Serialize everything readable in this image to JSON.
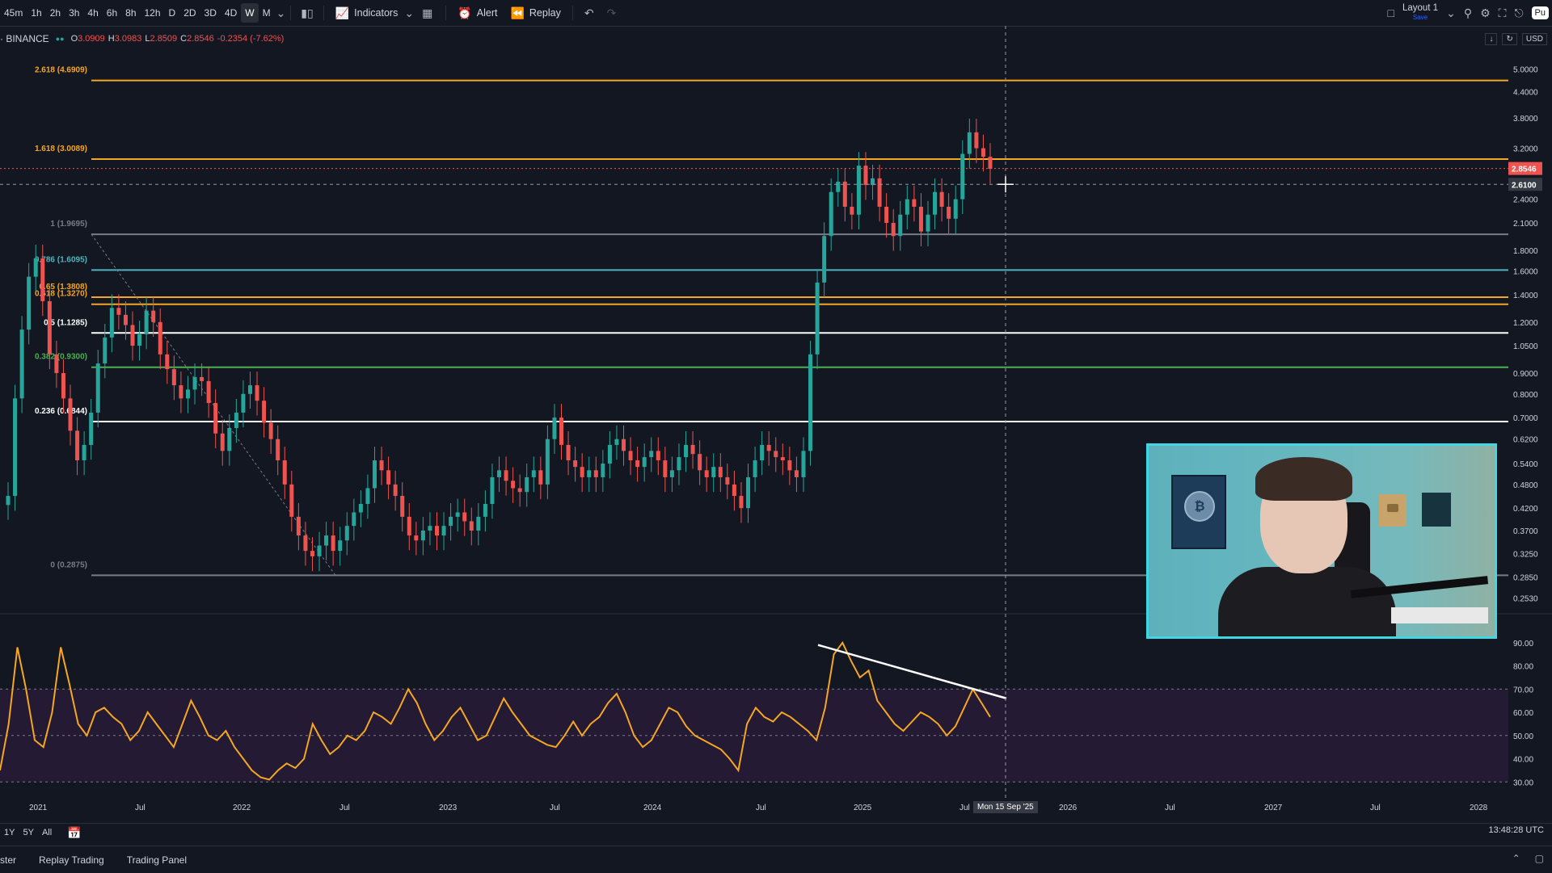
{
  "toolbar": {
    "timeframes": [
      "45m",
      "1h",
      "2h",
      "3h",
      "4h",
      "6h",
      "8h",
      "12h",
      "D",
      "2D",
      "3D",
      "4D",
      "W",
      "M"
    ],
    "active_timeframe": "W",
    "indicators_label": "Indicators",
    "alert_label": "Alert",
    "replay_label": "Replay",
    "layout_label": "Layout 1",
    "layout_save": "Save",
    "publish_label": "Pu"
  },
  "legend": {
    "exchange": "· BINANCE",
    "ohlc": [
      {
        "k": "O",
        "v": "3.0909"
      },
      {
        "k": "H",
        "v": "3.0983"
      },
      {
        "k": "L",
        "v": "2.8509"
      },
      {
        "k": "C",
        "v": "2.8546"
      },
      {
        "k": "",
        "v": "-0.2354 (-7.62%)"
      }
    ]
  },
  "axis_controls": {
    "currency": "USD"
  },
  "fib_levels": [
    {
      "label": "2.618 (4.6909)",
      "price": 4.6909,
      "color": "#f5a623",
      "labelColor": "#f5a623"
    },
    {
      "label": "1.618 (3.0089)",
      "price": 3.0089,
      "color": "#f5a623",
      "labelColor": "#f5a623"
    },
    {
      "label": "1 (1.9695)",
      "price": 1.9695,
      "color": "#787b86",
      "labelColor": "#787b86"
    },
    {
      "label": "0.786 (1.6095)",
      "price": 1.6095,
      "color": "#4fb3bf",
      "labelColor": "#4fb3bf"
    },
    {
      "label": "0.65 (1.3808)",
      "price": 1.3808,
      "color": "#f5a623",
      "labelColor": "#f5a623"
    },
    {
      "label": "0.618 (1.3270)",
      "price": 1.327,
      "color": "#f5a623",
      "labelColor": "#f5a623"
    },
    {
      "label": "0.5 (1.1285)",
      "price": 1.1285,
      "color": "#ffffff",
      "labelColor": "#ffffff"
    },
    {
      "label": "0.382 (0.9300)",
      "price": 0.93,
      "color": "#4caf50",
      "labelColor": "#4caf50"
    },
    {
      "label": "0.236 (0.6844)",
      "price": 0.6844,
      "color": "#ffffff",
      "labelColor": "#ffffff"
    },
    {
      "label": "0 (0.2875)",
      "price": 0.2875,
      "color": "#787b86",
      "labelColor": "#787b86"
    }
  ],
  "price_ticks": [
    "5.0000",
    "4.4000",
    "3.8000",
    "3.2000",
    "2.4000",
    "2.1000",
    "1.8000",
    "1.6000",
    "1.4000",
    "1.2000",
    "1.0500",
    "0.9000",
    "0.8000",
    "0.7000",
    "0.6200",
    "0.5400",
    "0.4800",
    "0.4200",
    "0.3700",
    "0.3250",
    "0.2850",
    "0.2530"
  ],
  "price_tick_values": [
    5.0,
    4.4,
    3.8,
    3.2,
    2.4,
    2.1,
    1.8,
    1.6,
    1.4,
    1.2,
    1.05,
    0.9,
    0.8,
    0.7,
    0.62,
    0.54,
    0.48,
    0.42,
    0.37,
    0.325,
    0.285,
    0.253
  ],
  "price_badges": [
    {
      "text": "2.8546",
      "price": 2.8546,
      "bg": "#ef5350"
    },
    {
      "text": "2.6100",
      "price": 2.61,
      "bg": "#363a45"
    }
  ],
  "rsi_ticks": [
    "90.00",
    "80.00",
    "70.00",
    "60.00",
    "50.00",
    "40.00",
    "30.00"
  ],
  "rsi_tick_values": [
    90,
    80,
    70,
    60,
    50,
    40,
    30
  ],
  "time_labels": [
    "2021",
    "Jul",
    "2022",
    "Jul",
    "2023",
    "Jul",
    "2024",
    "Jul",
    "2025",
    "Jul",
    "2026",
    "Jul",
    "2027",
    "Jul",
    "2028"
  ],
  "crosshair_time": "Mon 15 Sep '25",
  "range_buttons": [
    "1Y",
    "5Y",
    "All"
  ],
  "clock": "13:48:28 UTC",
  "panel_tabs": [
    "ster",
    "Replay Trading",
    "Trading Panel"
  ],
  "chart_data": {
    "type": "candlestick",
    "price_scale": "log",
    "ylim": [
      0.24,
      5.2
    ],
    "rsi_levels": [
      70,
      50,
      30
    ],
    "closes": [
      0.45,
      0.78,
      1.15,
      1.55,
      1.72,
      1.35,
      1.0,
      0.9,
      0.78,
      0.65,
      0.55,
      0.6,
      0.72,
      0.95,
      1.1,
      1.3,
      1.25,
      1.18,
      1.05,
      1.12,
      1.28,
      1.2,
      1.0,
      0.92,
      0.84,
      0.78,
      0.82,
      0.88,
      0.86,
      0.76,
      0.64,
      0.58,
      0.66,
      0.72,
      0.8,
      0.84,
      0.77,
      0.68,
      0.62,
      0.55,
      0.48,
      0.4,
      0.36,
      0.33,
      0.32,
      0.34,
      0.36,
      0.33,
      0.35,
      0.38,
      0.41,
      0.43,
      0.47,
      0.55,
      0.52,
      0.48,
      0.45,
      0.4,
      0.36,
      0.35,
      0.37,
      0.38,
      0.36,
      0.38,
      0.4,
      0.41,
      0.39,
      0.37,
      0.4,
      0.43,
      0.5,
      0.52,
      0.49,
      0.47,
      0.46,
      0.5,
      0.52,
      0.48,
      0.62,
      0.7,
      0.6,
      0.55,
      0.53,
      0.5,
      0.52,
      0.5,
      0.54,
      0.6,
      0.62,
      0.58,
      0.55,
      0.53,
      0.56,
      0.58,
      0.55,
      0.5,
      0.52,
      0.56,
      0.6,
      0.57,
      0.52,
      0.5,
      0.53,
      0.5,
      0.48,
      0.45,
      0.42,
      0.5,
      0.55,
      0.6,
      0.58,
      0.56,
      0.55,
      0.52,
      0.5,
      0.58,
      1.0,
      1.5,
      1.95,
      2.5,
      2.65,
      2.3,
      2.2,
      2.9,
      2.6,
      2.7,
      2.3,
      2.1,
      1.95,
      2.2,
      2.4,
      2.3,
      2.0,
      2.2,
      2.5,
      2.3,
      2.15,
      2.4,
      3.1,
      3.5,
      3.2,
      3.05,
      2.85
    ],
    "rsi": [
      35,
      55,
      88,
      70,
      48,
      45,
      60,
      88,
      72,
      55,
      50,
      60,
      62,
      58,
      55,
      48,
      52,
      60,
      55,
      50,
      45,
      55,
      65,
      58,
      50,
      48,
      52,
      45,
      40,
      35,
      32,
      31,
      35,
      38,
      36,
      40,
      55,
      48,
      42,
      45,
      50,
      48,
      52,
      60,
      58,
      55,
      62,
      70,
      64,
      55,
      48,
      52,
      58,
      62,
      55,
      48,
      50,
      58,
      66,
      60,
      55,
      50,
      48,
      46,
      45,
      50,
      56,
      50,
      55,
      58,
      64,
      68,
      60,
      50,
      45,
      48,
      55,
      62,
      60,
      54,
      50,
      48,
      46,
      44,
      40,
      35,
      55,
      62,
      58,
      56,
      60,
      58,
      55,
      52,
      48,
      62,
      85,
      90,
      82,
      75,
      78,
      65,
      60,
      55,
      52,
      56,
      60,
      58,
      55,
      50,
      54,
      62,
      70,
      64,
      58
    ]
  }
}
